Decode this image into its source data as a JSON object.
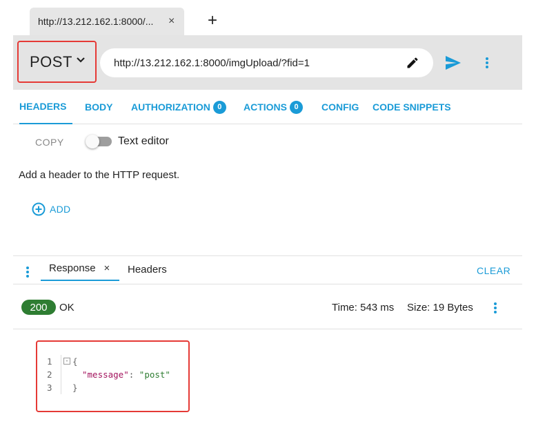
{
  "browser_tab": {
    "title": "http://13.212.162.1:8000/...",
    "close": "×",
    "new_tab": "+"
  },
  "request": {
    "method": "POST",
    "url": "http://13.212.162.1:8000/imgUpload/?fid=1"
  },
  "tabs": [
    {
      "label": "HEADERS",
      "active": true
    },
    {
      "label": "BODY"
    },
    {
      "label": "AUTHORIZATION",
      "count": "0"
    },
    {
      "label": "ACTIONS",
      "count": "0"
    },
    {
      "label": "CONFIG"
    },
    {
      "label": "CODE SNIPPETS"
    }
  ],
  "headers_panel": {
    "copy_label": "COPY",
    "text_editor_label": "Text editor",
    "hint": "Add a header to the HTTP request.",
    "add_label": "ADD"
  },
  "response": {
    "tab_label": "Response",
    "tab_close": "×",
    "headers_tab": "Headers",
    "clear_label": "CLEAR",
    "status_code": "200",
    "status_text": "OK",
    "time": "Time: 543 ms",
    "size": "Size: 19 Bytes",
    "body": {
      "line_numbers": [
        "1",
        "2",
        "3"
      ],
      "fold": "-",
      "open_brace": "{",
      "key": "\"message\"",
      "colon": ": ",
      "value": "\"post\"",
      "close_brace": "}"
    }
  },
  "colors": {
    "accent": "#1a9bd7",
    "status_ok": "#2e7d32",
    "highlight": "#e53935"
  }
}
